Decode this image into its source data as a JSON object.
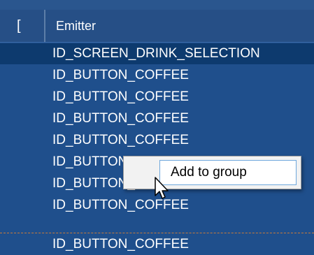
{
  "table": {
    "columns": [
      "[",
      "Emitter"
    ],
    "rows": [
      {
        "emitter": "ID_SCREEN_DRINK_SELECTION",
        "selected": true
      },
      {
        "emitter": "ID_BUTTON_COFFEE",
        "selected": false
      },
      {
        "emitter": "ID_BUTTON_COFFEE",
        "selected": false
      },
      {
        "emitter": "ID_BUTTON_COFFEE",
        "selected": false
      },
      {
        "emitter": "ID_BUTTON_COFFEE",
        "selected": false
      },
      {
        "emitter": "ID_BUTTON_COFFEE",
        "selected": false
      },
      {
        "emitter": "ID_BUTTON_COFFEE",
        "selected": false
      },
      {
        "emitter": "ID_BUTTON_COFFEE",
        "selected": false
      },
      {
        "emitter": "ID_BUTTON_COFFEE",
        "selected": false
      }
    ]
  },
  "context_menu": {
    "items": [
      {
        "label": "Add to group"
      }
    ]
  },
  "colors": {
    "background": "#1f4f8c",
    "selected_row": "#0d3a6e",
    "text": "#ffffff",
    "separator": "#c77a3a"
  },
  "cursor": {
    "icon": "arrow-cursor-icon"
  }
}
